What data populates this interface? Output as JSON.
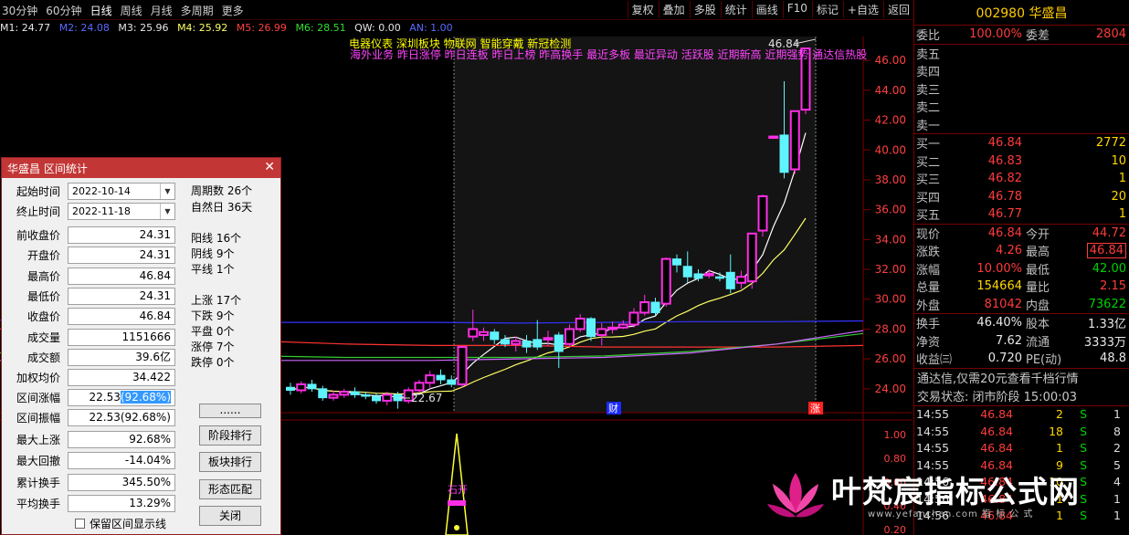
{
  "toolbar": {
    "periods": [
      "30分钟",
      "60分钟",
      "日线",
      "周线",
      "月线",
      "多周期",
      "更多"
    ],
    "active_period": "日线",
    "buttons": [
      "复权",
      "叠加",
      "多股",
      "统计",
      "画线",
      "F10",
      "标记",
      "+自选",
      "返回"
    ]
  },
  "ma": {
    "m1": "M1: 24.77",
    "m2": "M2: 24.08",
    "m3": "M3: 25.96",
    "m4": "M4: 25.92",
    "m5": "M5: 26.99",
    "m6": "M6: 28.51",
    "qw": "QW: 0.00",
    "an": "AN: 1.00"
  },
  "concept_tags": {
    "line1": "电器仪表  深圳板块  物联网 智能穿戴 新冠检测",
    "line2": "海外业务 昨日涨停 昨日连板 昨日上榜 昨高换手 最近多板 最近异动 活跃股 近期新高 近期强势 通达信热股"
  },
  "chart_data": {
    "type": "candlestick",
    "y_axis_ticks": [
      24.0,
      26.0,
      28.0,
      30.0,
      32.0,
      34.0,
      36.0,
      38.0,
      40.0,
      42.0,
      44.0,
      46.0
    ],
    "y_axis_labels": [
      "24.00",
      "26.00",
      "28.00",
      "30.00",
      "32.00",
      "34.00",
      "36.00",
      "38.00",
      "40.00",
      "42.00",
      "44.00",
      "46.00"
    ],
    "ylim": [
      22.4,
      47.6
    ],
    "annotations": {
      "high_marker": "46.84",
      "low_marker": "22.67",
      "x_marks": [
        "财",
        "涨"
      ],
      "event_label": "石开"
    },
    "candles": [
      {
        "o": 24.1,
        "c": 23.9,
        "h": 24.4,
        "l": 23.6
      },
      {
        "o": 23.9,
        "c": 24.3,
        "h": 24.5,
        "l": 23.7
      },
      {
        "o": 24.3,
        "c": 24.0,
        "h": 24.6,
        "l": 23.8
      },
      {
        "o": 24.0,
        "c": 23.4,
        "h": 24.2,
        "l": 23.2
      },
      {
        "o": 23.4,
        "c": 23.6,
        "h": 23.9,
        "l": 23.2
      },
      {
        "o": 23.6,
        "c": 23.8,
        "h": 24.0,
        "l": 23.4
      },
      {
        "o": 23.8,
        "c": 23.6,
        "h": 24.1,
        "l": 23.4
      },
      {
        "o": 23.6,
        "c": 23.5,
        "h": 23.8,
        "l": 23.3
      },
      {
        "o": 23.5,
        "c": 23.2,
        "h": 23.7,
        "l": 23.0
      },
      {
        "o": 23.2,
        "c": 23.6,
        "h": 23.8,
        "l": 22.9
      },
      {
        "o": 23.6,
        "c": 23.2,
        "h": 23.8,
        "l": 22.67
      },
      {
        "o": 23.2,
        "c": 23.9,
        "h": 24.1,
        "l": 23.0
      },
      {
        "o": 23.9,
        "c": 24.4,
        "h": 24.6,
        "l": 23.7
      },
      {
        "o": 24.4,
        "c": 24.9,
        "h": 25.2,
        "l": 24.0
      },
      {
        "o": 24.9,
        "c": 24.6,
        "h": 25.3,
        "l": 24.3
      },
      {
        "o": 24.6,
        "c": 24.3,
        "h": 24.9,
        "l": 24.1
      },
      {
        "o": 24.3,
        "c": 26.8,
        "h": 26.8,
        "l": 24.1
      },
      {
        "o": 27.5,
        "c": 28.0,
        "h": 29.3,
        "l": 27.2
      },
      {
        "o": 27.6,
        "c": 27.8,
        "h": 28.1,
        "l": 27.2
      },
      {
        "o": 27.8,
        "c": 27.3,
        "h": 28.0,
        "l": 27.0
      },
      {
        "o": 27.3,
        "c": 27.0,
        "h": 27.6,
        "l": 26.8
      },
      {
        "o": 27.0,
        "c": 27.2,
        "h": 27.5,
        "l": 26.5
      },
      {
        "o": 27.2,
        "c": 26.8,
        "h": 27.6,
        "l": 26.4
      },
      {
        "o": 27.3,
        "c": 26.8,
        "h": 28.6,
        "l": 26.6
      },
      {
        "o": 27.3,
        "c": 27.4,
        "h": 27.9,
        "l": 26.9
      },
      {
        "o": 27.6,
        "c": 26.5,
        "h": 27.8,
        "l": 25.4
      },
      {
        "o": 27.0,
        "c": 28.0,
        "h": 28.3,
        "l": 26.8
      },
      {
        "o": 28.0,
        "c": 28.7,
        "h": 29.0,
        "l": 27.8
      },
      {
        "o": 28.7,
        "c": 27.5,
        "h": 28.8,
        "l": 27.2
      },
      {
        "o": 27.6,
        "c": 28.0,
        "h": 28.4,
        "l": 26.9
      },
      {
        "o": 28.0,
        "c": 28.1,
        "h": 28.5,
        "l": 27.7
      },
      {
        "o": 28.1,
        "c": 28.3,
        "h": 28.6,
        "l": 28.0
      },
      {
        "o": 28.3,
        "c": 29.1,
        "h": 29.4,
        "l": 28.1
      },
      {
        "o": 29.1,
        "c": 29.8,
        "h": 30.3,
        "l": 28.9
      },
      {
        "o": 29.8,
        "c": 29.1,
        "h": 30.1,
        "l": 28.9
      },
      {
        "o": 29.7,
        "c": 32.7,
        "h": 32.8,
        "l": 29.5
      },
      {
        "o": 32.7,
        "c": 32.3,
        "h": 33.0,
        "l": 31.8
      },
      {
        "o": 32.2,
        "c": 31.5,
        "h": 33.2,
        "l": 31.1
      },
      {
        "o": 31.7,
        "c": 31.4,
        "h": 32.0,
        "l": 31.2
      },
      {
        "o": 31.6,
        "c": 31.7,
        "h": 32.0,
        "l": 31.4
      },
      {
        "o": 31.5,
        "c": 31.4,
        "h": 31.8,
        "l": 31.2
      },
      {
        "o": 31.8,
        "c": 30.7,
        "h": 33.0,
        "l": 30.4
      },
      {
        "o": 31.1,
        "c": 31.5,
        "h": 31.9,
        "l": 30.7
      },
      {
        "o": 31.2,
        "c": 34.4,
        "h": 34.4,
        "l": 30.7
      },
      {
        "o": 34.6,
        "c": 36.9,
        "h": 37.0,
        "l": 34.2
      },
      {
        "o": 40.9,
        "c": 40.9,
        "h": 40.9,
        "l": 40.9
      },
      {
        "o": 41.0,
        "c": 38.5,
        "h": 44.6,
        "l": 38.1
      },
      {
        "o": 38.7,
        "c": 42.6,
        "h": 42.6,
        "l": 38.4
      },
      {
        "o": 42.7,
        "c": 46.8,
        "h": 46.8,
        "l": 42.4
      }
    ]
  },
  "quote": {
    "code_name": "002980 华盛昌",
    "weibi_label": "委比",
    "weibi": "100.00%",
    "weicha_label": "委差",
    "weicha": "2804",
    "asks": [
      {
        "label": "卖五",
        "price": "",
        "vol": ""
      },
      {
        "label": "卖四",
        "price": "",
        "vol": ""
      },
      {
        "label": "卖三",
        "price": "",
        "vol": ""
      },
      {
        "label": "卖二",
        "price": "",
        "vol": ""
      },
      {
        "label": "卖一",
        "price": "",
        "vol": ""
      }
    ],
    "bids": [
      {
        "label": "买一",
        "price": "46.84",
        "vol": "2772"
      },
      {
        "label": "买二",
        "price": "46.83",
        "vol": "10"
      },
      {
        "label": "买三",
        "price": "46.82",
        "vol": "1"
      },
      {
        "label": "买四",
        "price": "46.78",
        "vol": "20"
      },
      {
        "label": "买五",
        "price": "46.77",
        "vol": "1"
      }
    ],
    "stats1": [
      {
        "l1": "现价",
        "v1": "46.84",
        "c1": "red",
        "l2": "今开",
        "v2": "44.72",
        "c2": "red",
        "box": false
      },
      {
        "l1": "涨跌",
        "v1": "4.26",
        "c1": "red",
        "l2": "最高",
        "v2": "46.84",
        "c2": "red",
        "box": true
      },
      {
        "l1": "涨幅",
        "v1": "10.00%",
        "c1": "red",
        "l2": "最低",
        "v2": "42.00",
        "c2": "green",
        "box": false
      },
      {
        "l1": "总量",
        "v1": "154664",
        "c1": "yellow",
        "l2": "量比",
        "v2": "2.15",
        "c2": "red",
        "box": false
      },
      {
        "l1": "外盘",
        "v1": "81042",
        "c1": "red",
        "l2": "内盘",
        "v2": "73622",
        "c2": "green",
        "box": false
      }
    ],
    "stats2": [
      {
        "l1": "换手",
        "v1": "46.40%",
        "c1": "white",
        "l2": "股本",
        "v2": "1.33亿",
        "c2": "white"
      },
      {
        "l1": "净资",
        "v1": "7.62",
        "c1": "white",
        "l2": "流通",
        "v2": "3333万",
        "c2": "white"
      },
      {
        "l1": "收益㈢",
        "v1": "0.720",
        "c1": "white",
        "l2": "PE(动)",
        "v2": "48.8",
        "c2": "white"
      }
    ],
    "ad_text": "通达信,仅需20元查看千档行情",
    "status_text": "交易状态: 闭市阶段 15:00:03",
    "ticks": [
      {
        "time": "14:55",
        "price": "46.84",
        "vol": "2",
        "dir": "S",
        "cnt": "1"
      },
      {
        "time": "14:55",
        "price": "46.84",
        "vol": "18",
        "dir": "S",
        "cnt": "8"
      },
      {
        "time": "14:55",
        "price": "46.84",
        "vol": "1",
        "dir": "S",
        "cnt": "2"
      },
      {
        "time": "14:55",
        "price": "46.84",
        "vol": "9",
        "dir": "S",
        "cnt": "5"
      },
      {
        "time": "14:56",
        "price": "46.84",
        "vol": "10",
        "dir": "S",
        "cnt": "4"
      },
      {
        "time": "14:56",
        "price": "46.84",
        "vol": "1",
        "dir": "S",
        "cnt": "1"
      },
      {
        "time": "14:56",
        "price": "46.84",
        "vol": "1",
        "dir": "S",
        "cnt": "1"
      }
    ]
  },
  "sub_axis": [
    "1.00",
    "0.80",
    "0.60",
    "0.40",
    "0.20"
  ],
  "dialog": {
    "title": "华盛昌 区间统计",
    "start_label": "起始时间",
    "start_value": "2022-10-14",
    "end_label": "终止时间",
    "end_value": "2022-11-18",
    "fields": [
      {
        "label": "前收盘价",
        "value": "24.31"
      },
      {
        "label": "开盘价",
        "value": "24.31"
      },
      {
        "label": "最高价",
        "value": "46.84"
      },
      {
        "label": "最低价",
        "value": "24.31"
      },
      {
        "label": "收盘价",
        "value": "46.84"
      },
      {
        "label": "成交量",
        "value": "1151666"
      },
      {
        "label": "成交额",
        "value": "39.6亿"
      },
      {
        "label": "加权均价",
        "value": "34.422"
      }
    ],
    "range_change_label": "区间涨幅",
    "range_change_plain": "22.53",
    "range_change_sel": "(92.68%)",
    "fields2": [
      {
        "label": "区间振幅",
        "value": "22.53(92.68%)"
      },
      {
        "label": "最大上涨",
        "value": "92.68%"
      },
      {
        "label": "最大回撤",
        "value": "-14.04%"
      },
      {
        "label": "累计换手",
        "value": "345.50%"
      },
      {
        "label": "平均换手",
        "value": "13.29%"
      }
    ],
    "stats": {
      "periods": "周期数 26个",
      "natural_days": "自然日 36天",
      "yang": "阳线 16个",
      "yin": "阴线 9个",
      "flat": "平线 1个",
      "up": "上涨 17个",
      "down": "下跌 9个",
      "flat2": "平盘 0个",
      "limit_up": "涨停 7个",
      "limit_down": "跌停 0个"
    },
    "buttons": {
      "more": "......",
      "stage_rank": "阶段排行",
      "sector_rank": "板块排行",
      "pattern_match": "形态匹配",
      "close": "关闭"
    },
    "checkbox_label": "保留区间显示线"
  },
  "watermark": {
    "text": "叶梵宸指标公式网",
    "sub": "www.yefanchen.com  指 标 公 式"
  },
  "colors": {
    "up": "#ff2ee6",
    "down": "#5ff3ff",
    "ma_white": "#ffffff",
    "ma_yellow": "#ffff66",
    "ma_blue": "#3333ff",
    "ma_red": "#ff3333",
    "ma_green": "#33cc33",
    "ma_purple": "#cc66ff",
    "grid": "#7a0000",
    "quote_red": "#ff3b3b",
    "quote_green": "#00d200"
  }
}
